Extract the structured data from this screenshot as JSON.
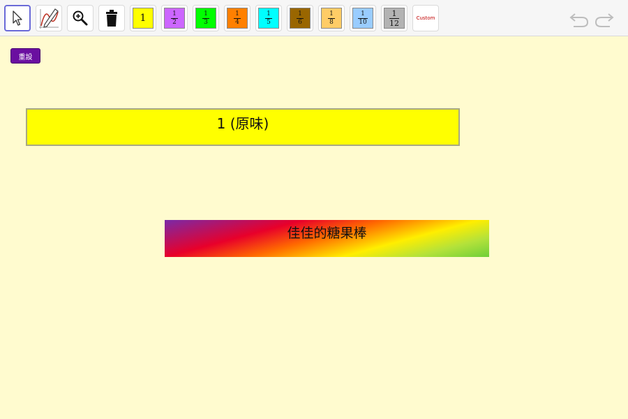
{
  "toolbar": {
    "tools": [
      {
        "name": "move-tool",
        "icon": "arrow-cursor-icon",
        "selected": true
      },
      {
        "name": "pen-tool",
        "icon": "pen-graph-icon"
      },
      {
        "name": "zoom-tool",
        "icon": "zoom-in-icon"
      },
      {
        "name": "delete-tool",
        "icon": "trash-icon"
      }
    ],
    "fractions": [
      {
        "label": "1",
        "color": "#ffff00"
      },
      {
        "numerator": "1",
        "denominator": "2",
        "color": "#cc66ff"
      },
      {
        "numerator": "1",
        "denominator": "3",
        "color": "#00ff00"
      },
      {
        "numerator": "1",
        "denominator": "4",
        "color": "#ff8000"
      },
      {
        "numerator": "1",
        "denominator": "5",
        "color": "#00ffff"
      },
      {
        "numerator": "1",
        "denominator": "6",
        "color": "#996600"
      },
      {
        "numerator": "1",
        "denominator": "8",
        "color": "#ffcc66"
      },
      {
        "numerator": "1",
        "denominator": "10",
        "color": "#99ccff"
      },
      {
        "numerator": "1",
        "denominator": "12",
        "color": "#b3b3b3"
      }
    ],
    "custom_label": "Custom",
    "undo_icon": "undo-icon",
    "redo_icon": "redo-icon"
  },
  "reset_button": {
    "label": "重設",
    "color": "#6a0fa0"
  },
  "whole_bar": {
    "label": "1 (原味)",
    "color": "#ffff00"
  },
  "candy_bar": {
    "label": "佳佳的糖果棒"
  }
}
